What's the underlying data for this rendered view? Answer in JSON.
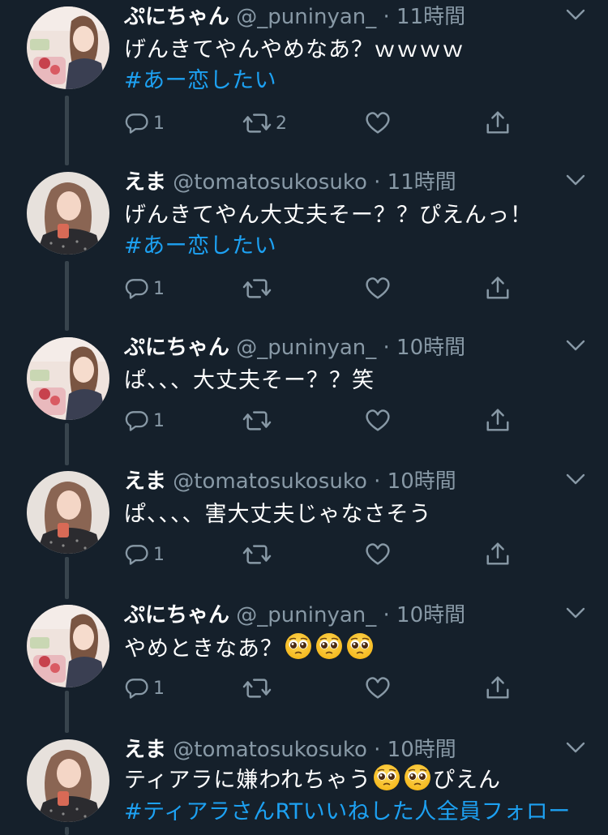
{
  "colors": {
    "background": "#15202b",
    "text": "#ffffff",
    "muted": "#8899a6",
    "link": "#1da1f2",
    "thread_line": "#38444d"
  },
  "tweets": [
    {
      "name": "ぷにちゃん",
      "handle": "@_puninyan_",
      "separator": "·",
      "time": "11時間",
      "text": "げんきてやんやめなあ？ｗｗｗｗ",
      "hashtag": "#あー恋したい",
      "reply_count": "1",
      "retweet_count": "2"
    },
    {
      "name": "えま",
      "handle": "@tomatosukosuko",
      "separator": "·",
      "time": "11時間",
      "text": "げんきてやん大丈夫そー？？ぴえんっ！",
      "hashtag": "#あー恋したい",
      "reply_count": "1",
      "retweet_count": ""
    },
    {
      "name": "ぷにちゃん",
      "handle": "@_puninyan_",
      "separator": "·",
      "time": "10時間",
      "text": "ぱ、、、大丈夫そー？？笑",
      "reply_count": "1",
      "retweet_count": ""
    },
    {
      "name": "えま",
      "handle": "@tomatosukosuko",
      "separator": "·",
      "time": "10時間",
      "text": "ぱ、、、、害大丈夫じゃなさそう",
      "reply_count": "1",
      "retweet_count": ""
    },
    {
      "name": "ぷにちゃん",
      "handle": "@_puninyan_",
      "separator": "·",
      "time": "10時間",
      "text": "やめときなあ？",
      "reply_count": "1",
      "retweet_count": ""
    },
    {
      "name": "えま",
      "handle": "@tomatosukosuko",
      "separator": "·",
      "time": "10時間",
      "text_a": "ティアラに嫌われちゃう",
      "text_b": "ぴえん",
      "hashtag": "#ティアラさんRTいいねした人全員フォロー"
    }
  ],
  "icons": {
    "reply": "reply-icon",
    "retweet": "retweet-icon",
    "like": "heart-icon",
    "share": "share-icon",
    "more": "chevron-down-icon",
    "emoji": "pleading-face-emoji"
  }
}
